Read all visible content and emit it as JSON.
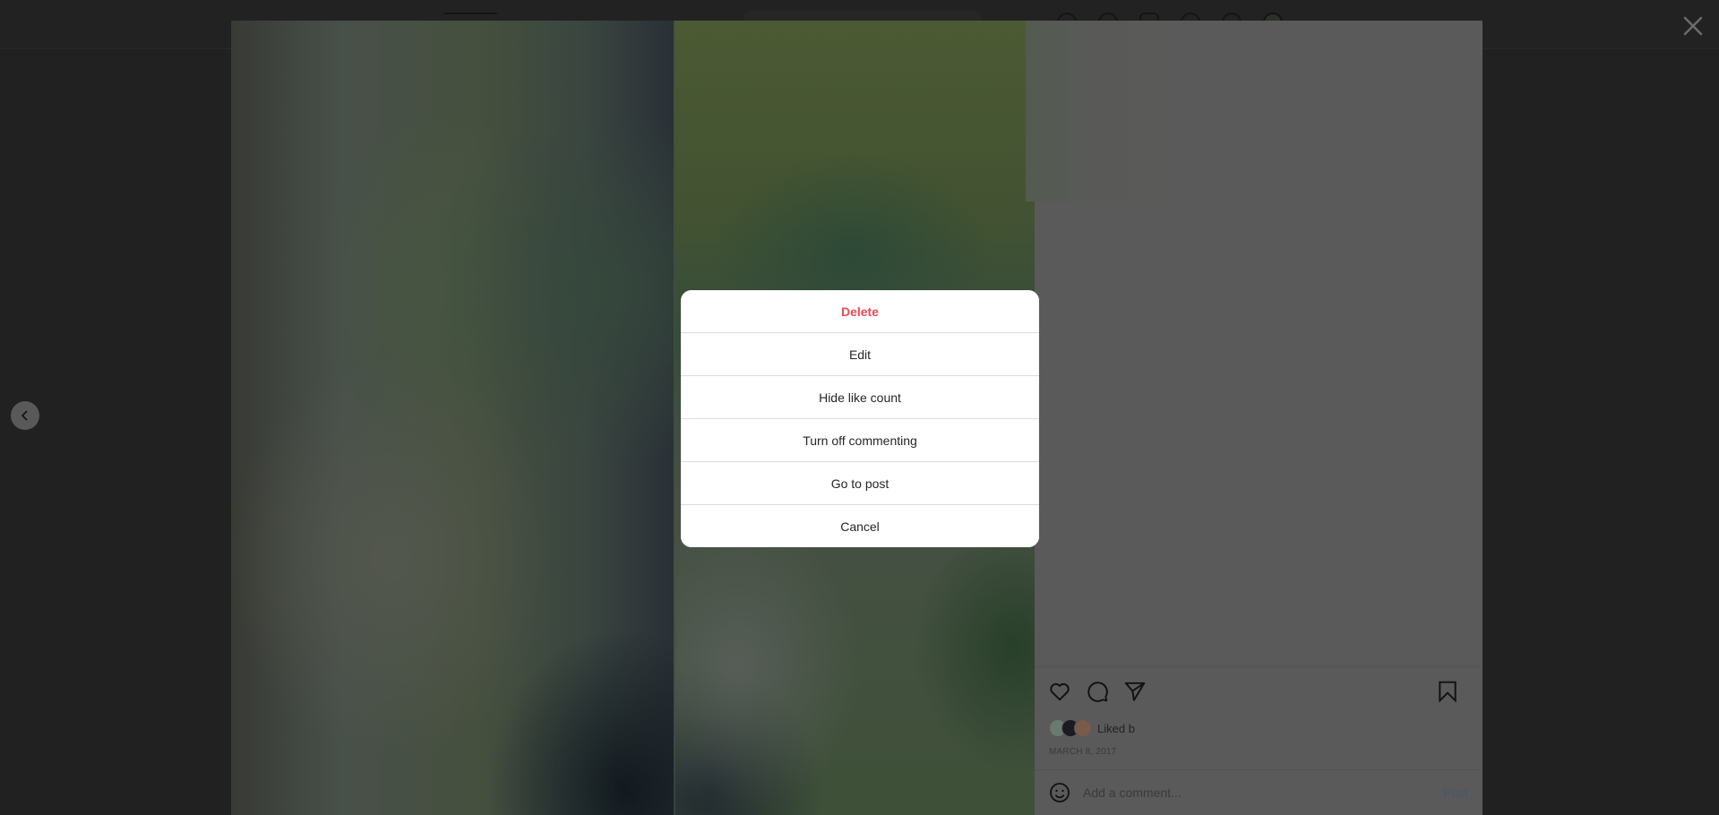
{
  "navbar": {
    "icons": [
      "home-icon",
      "messenger-icon",
      "new-post-icon",
      "explore-icon",
      "activity-icon",
      "profile-avatar"
    ]
  },
  "overlay": {
    "close_icon": "close-icon",
    "prev_icon": "chevron-left-icon"
  },
  "post": {
    "actions": {
      "like_icon": "heart-icon",
      "comment_icon": "comment-icon",
      "share_icon": "share-icon",
      "save_icon": "bookmark-icon"
    },
    "liked_by_text": "Liked b",
    "liked_avatars": [
      "#6a7a70",
      "#1c1a22",
      "#7a5a4a"
    ],
    "date": "March 8, 2017",
    "comment": {
      "placeholder": "Add a comment...",
      "value": "",
      "post_label": "Post",
      "emoji_icon": "emoji-icon"
    }
  },
  "options_dialog": {
    "items": [
      {
        "label": "Delete",
        "style": "danger"
      },
      {
        "label": "Edit",
        "style": "normal"
      },
      {
        "label": "Hide like count",
        "style": "normal"
      },
      {
        "label": "Turn off commenting",
        "style": "normal"
      },
      {
        "label": "Go to post",
        "style": "normal"
      },
      {
        "label": "Cancel",
        "style": "normal"
      }
    ]
  },
  "colors": {
    "danger": "#ed4956",
    "overlay": "#212121",
    "panel": "#5a5a5a",
    "post_link": "#43586b"
  }
}
